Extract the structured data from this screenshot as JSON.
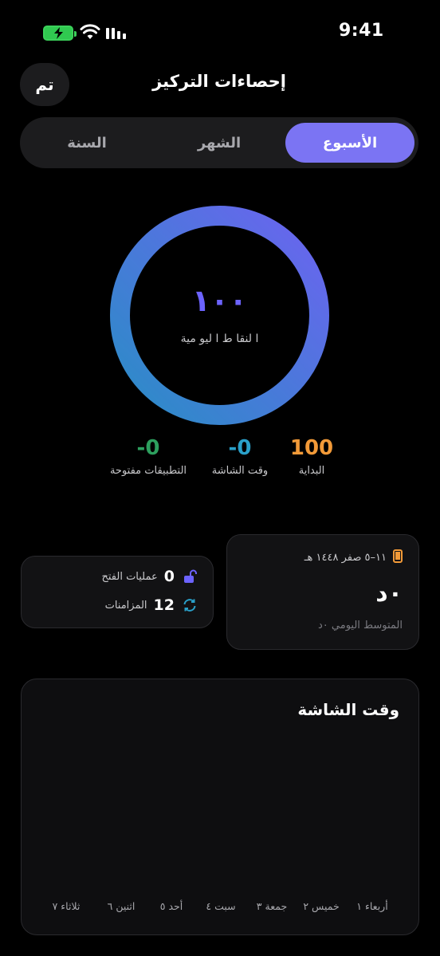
{
  "status_bar": {
    "time": "9:41"
  },
  "header": {
    "done_label": "تم",
    "title": "إحصاءات التركيز"
  },
  "segments": {
    "week": "الأسبوع",
    "month": "الشهر",
    "year": "السنة"
  },
  "ring": {
    "value": "١٠٠",
    "label": "ا لنقا ط  ا ليو مية",
    "progress": 1.0
  },
  "stats": {
    "start": {
      "value": "100",
      "label": "البداية",
      "color": "#f29a38"
    },
    "screen_time": {
      "value": "-0",
      "label": "وقت الشاشة",
      "color": "#2aa0c9"
    },
    "open_apps": {
      "value": "-0",
      "label": "التطبيقات مفتوحة",
      "color": "#2d9f5e"
    }
  },
  "activity_card": {
    "opens_count": "0",
    "opens_label": "عمليات الفتح",
    "syncs_count": "12",
    "syncs_label": "المزامنات"
  },
  "daily_card": {
    "date": "١١–٥ صفر ١٤٤٨ هـ",
    "value": "٠د",
    "average": "المتوسط اليومي ٠د"
  },
  "screen_time_chart": {
    "title": "وقت الشاشة",
    "days": [
      "أربعاء ١",
      "خميس ٢",
      "جمعة ٣",
      "سبت ٤",
      "أحد ٥",
      "اثنين ٦",
      "ثلاثاء ٧"
    ]
  },
  "colors": {
    "accent": "#7b74f3",
    "ring_start": "#6c63f0",
    "ring_end": "#2a8dc6"
  }
}
